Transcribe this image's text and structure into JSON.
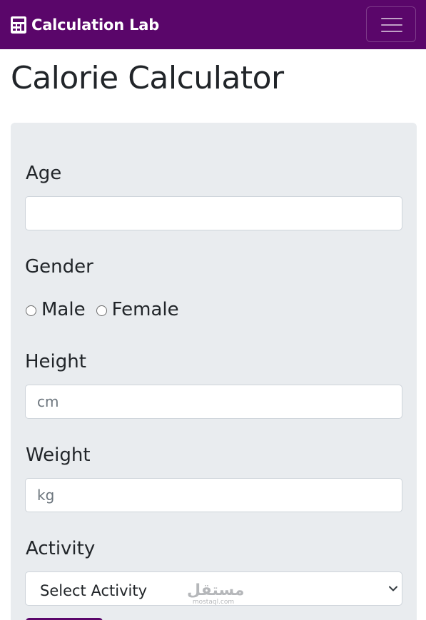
{
  "navbar": {
    "brand_label": "Calculation Lab",
    "brand_icon": "calculator-icon",
    "toggler_icon": "hamburger-menu-icon",
    "background_color": "#5a066a"
  },
  "page": {
    "title": "Calorie Calculator"
  },
  "form": {
    "age": {
      "label": "Age",
      "value": "",
      "placeholder": ""
    },
    "gender": {
      "label": "Gender",
      "options": [
        {
          "label": "Male",
          "checked": false
        },
        {
          "label": "Female",
          "checked": false
        }
      ]
    },
    "height": {
      "label": "Height",
      "value": "",
      "placeholder": "cm"
    },
    "weight": {
      "label": "Weight",
      "value": "",
      "placeholder": "kg"
    },
    "activity": {
      "label": "Activity",
      "selected": "Select Activity",
      "icon": "chevron-down-icon"
    }
  },
  "watermark": {
    "arabic": "مستقل",
    "latin": "mostaql.com"
  },
  "colors": {
    "accent": "#5a066a",
    "card_background": "#e9ecef"
  }
}
